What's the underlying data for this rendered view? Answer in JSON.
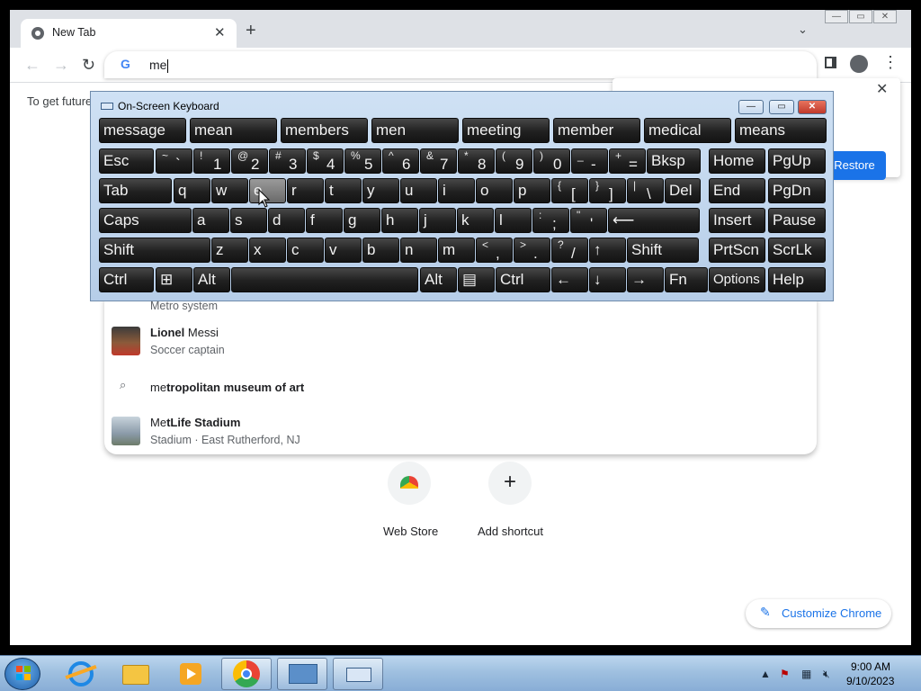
{
  "browser": {
    "tab_title": "New Tab",
    "address_value": "me",
    "infobar_text": "To get future",
    "restore_button": "Restore"
  },
  "suggestions": [
    {
      "line1_bold": "",
      "line1_rest": "",
      "line2": "Metro system"
    },
    {
      "line1_bold": "Lionel ",
      "line1_rest": "Messi",
      "line1_pre": "",
      "line2": "Soccer captain"
    },
    {
      "line1_pre": "me",
      "line1_bold": "tropolitan museum of art",
      "line2": ""
    },
    {
      "line1_pre": "Me",
      "line1_bold": "tLife Stadium",
      "line2": "Stadium · East Rutherford, NJ"
    }
  ],
  "shortcuts": {
    "webstore": "Web Store",
    "add": "Add shortcut",
    "customize": "Customize Chrome"
  },
  "osk": {
    "title": "On-Screen Keyboard",
    "predictions": [
      "message",
      "mean",
      "members",
      "men",
      "meeting",
      "member",
      "medical",
      "means"
    ],
    "row1": [
      "Esc",
      "`~",
      "1!",
      "2@",
      "3#",
      "4$",
      "5%",
      "6^",
      "7&",
      "8*",
      "9(",
      "0)",
      "-_",
      "=+",
      "Bksp",
      "Home",
      "PgUp"
    ],
    "row2": [
      "Tab",
      "q",
      "w",
      "e",
      "r",
      "t",
      "y",
      "u",
      "i",
      "o",
      "p",
      "[{",
      "]}",
      "\\|",
      "Del",
      "End",
      "PgDn"
    ],
    "row3": [
      "Caps",
      "a",
      "s",
      "d",
      "f",
      "g",
      "h",
      "j",
      "k",
      "l",
      ";:",
      "'\"",
      "⟵",
      "Insert",
      "Pause"
    ],
    "row4": [
      "Shift",
      "z",
      "x",
      "c",
      "v",
      "b",
      "n",
      "m",
      ",<",
      ".>",
      "/?",
      "↑",
      "Shift",
      "PrtScn",
      "ScrLk"
    ],
    "row5": [
      "Ctrl",
      "⊞",
      "Alt",
      "",
      "Alt",
      "▤",
      "Ctrl",
      "←",
      "↓",
      "→",
      "Fn",
      "Options",
      "Help"
    ]
  },
  "taskbar": {
    "time": "9:00 AM",
    "date": "9/10/2023"
  }
}
